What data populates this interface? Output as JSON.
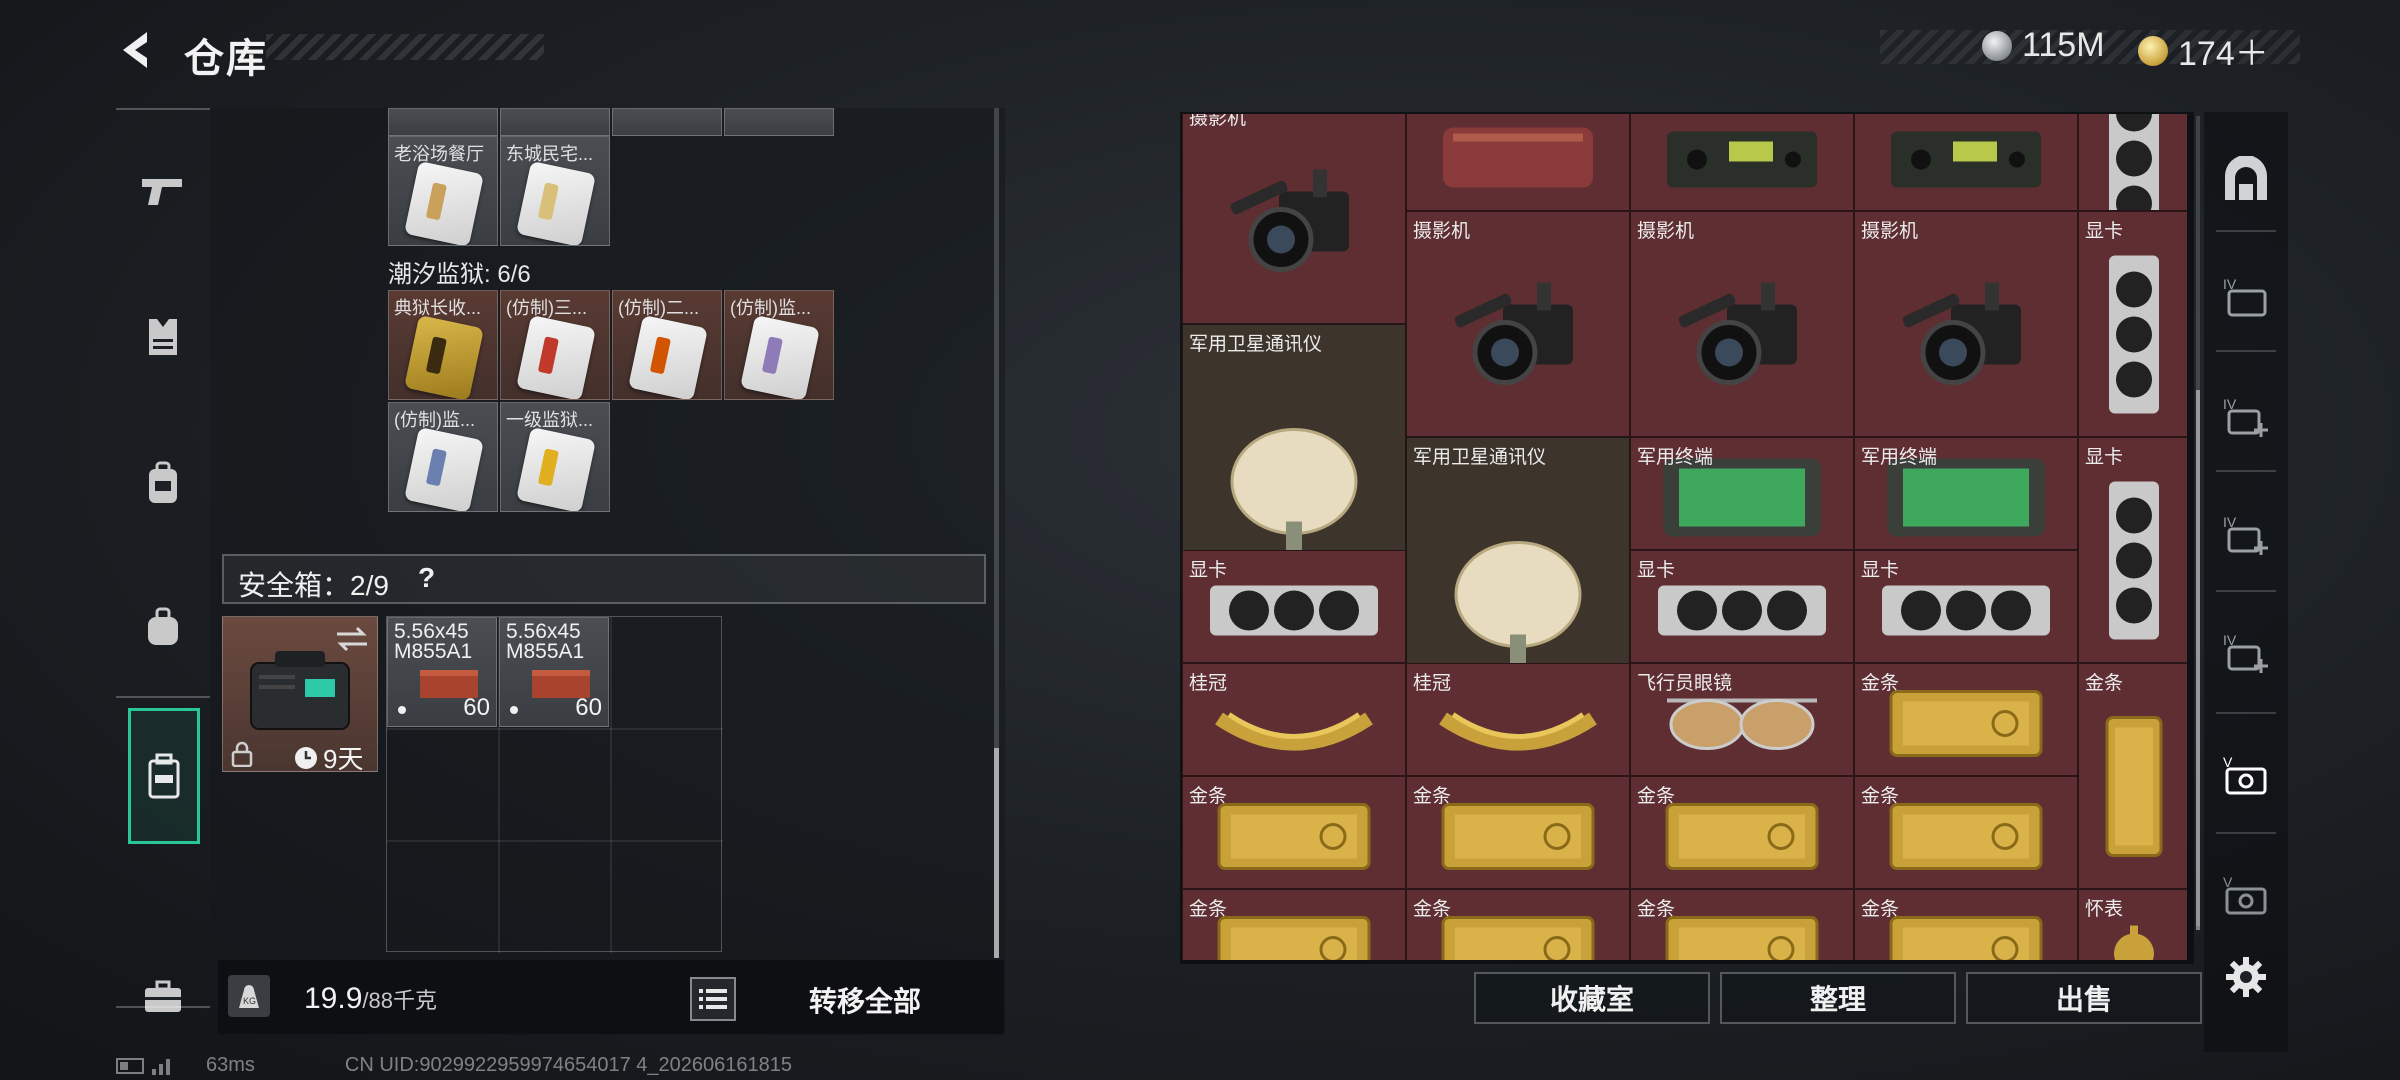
{
  "header": {
    "title": "仓库",
    "currencies": [
      {
        "icon": "silver-coin-icon",
        "amount": "115M"
      },
      {
        "icon": "gold-coin-icon",
        "amount": "174＋"
      }
    ]
  },
  "left_inventory": {
    "top_row_items": [
      {
        "label": "老浴场餐厅",
        "stripe": "#c9a15a"
      },
      {
        "label": "东城民宅...",
        "stripe": "#d8c07a"
      }
    ],
    "prison_label": "潮汐监狱: 6/6",
    "prison_items": [
      {
        "label": "典狱长收...",
        "stripe": "#c99a2a"
      },
      {
        "label": "(仿制)三...",
        "stripe": "#c0392b"
      },
      {
        "label": "(仿制)二...",
        "stripe": "#d35400"
      },
      {
        "label": "(仿制)监...",
        "stripe": "#8e7bb8"
      },
      {
        "label": "(仿制)监...",
        "stripe": "#6b7fb0"
      },
      {
        "label": "一级监狱...",
        "stripe": "#e0b020"
      }
    ],
    "safebox": {
      "label": "安全箱：2/9",
      "help": "?",
      "duration": "9天",
      "ammo": [
        {
          "caliber": "5.56x45",
          "type": "M855A1",
          "qty": "60"
        },
        {
          "caliber": "5.56x45",
          "type": "M855A1",
          "qty": "60"
        }
      ]
    },
    "weight_current": "19.9",
    "weight_max": "/88千克",
    "transfer_all": "转移全部"
  },
  "stash": {
    "cells": [
      {
        "label": "摄影机",
        "kind": "camera"
      },
      {
        "label": "",
        "kind": "case"
      },
      {
        "label": "",
        "kind": "radio"
      },
      {
        "label": "",
        "kind": "radio"
      },
      {
        "label": "",
        "kind": "gpu-v"
      },
      {
        "label": "摄影机",
        "kind": "camera"
      },
      {
        "label": "摄影机",
        "kind": "camera"
      },
      {
        "label": "摄影机",
        "kind": "camera"
      },
      {
        "label": "显卡",
        "kind": "gpu-v"
      },
      {
        "label": "军用卫星通讯仪",
        "kind": "dish"
      },
      {
        "label": "军用卫星通讯仪",
        "kind": "dish"
      },
      {
        "label": "军用终端",
        "kind": "terminal"
      },
      {
        "label": "军用终端",
        "kind": "terminal"
      },
      {
        "label": "显卡",
        "kind": "gpu-v"
      },
      {
        "label": "显卡",
        "kind": "gpu-h"
      },
      {
        "label": "显卡",
        "kind": "gpu-h"
      },
      {
        "label": "显卡",
        "kind": "gpu-h"
      },
      {
        "label": "桂冠",
        "kind": "laurel"
      },
      {
        "label": "桂冠",
        "kind": "laurel"
      },
      {
        "label": "飞行员眼镜",
        "kind": "glasses"
      },
      {
        "label": "金条",
        "kind": "gold-h"
      },
      {
        "label": "金条",
        "kind": "gold-v"
      },
      {
        "label": "金条",
        "kind": "gold-h"
      },
      {
        "label": "金条",
        "kind": "gold-h"
      },
      {
        "label": "金条",
        "kind": "gold-h"
      },
      {
        "label": "金条",
        "kind": "gold-h"
      },
      {
        "label": "金条",
        "kind": "gold-h"
      },
      {
        "label": "金条",
        "kind": "gold-h"
      },
      {
        "label": "金条",
        "kind": "gold-h"
      },
      {
        "label": "金条",
        "kind": "gold-h"
      },
      {
        "label": "怀表",
        "kind": "watch"
      }
    ]
  },
  "actions": {
    "collection": "收藏室",
    "organize": "整理",
    "sell": "出售"
  },
  "status": {
    "ping": "63ms",
    "uid": "CN UID:9029922959974654017 4_202606161815"
  },
  "colors": {
    "accent": "#27c79a",
    "stash_cell": "#5e2e33",
    "gold": "#c9a13a"
  }
}
